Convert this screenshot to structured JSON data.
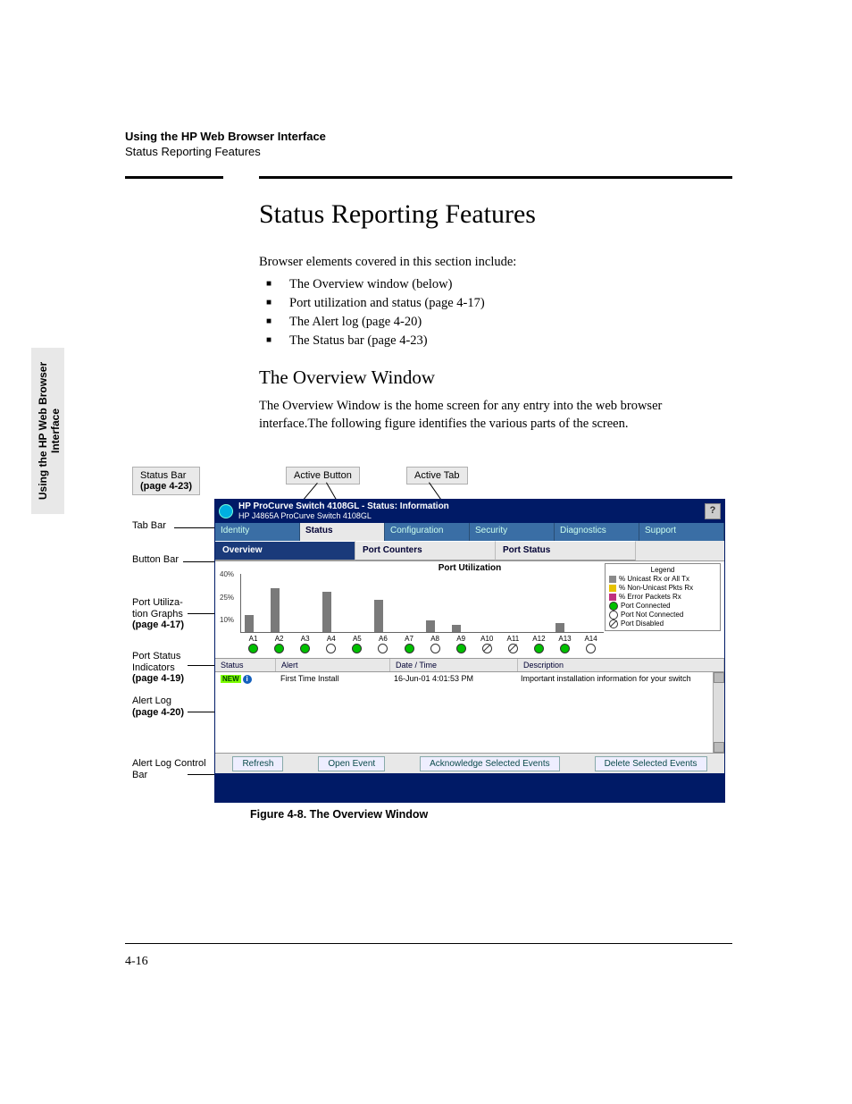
{
  "running_head": {
    "bold": "Using the HP Web Browser Interface",
    "reg": "Status Reporting Features"
  },
  "section_title": "Status Reporting Features",
  "intro": "Browser elements covered in this section include:",
  "bullets": [
    "The Overview window (below)",
    "Port utilization and status (page 4-17)",
    "The Alert log (page 4-20)",
    "The Status bar (page 4-23)"
  ],
  "subhead": "The Overview Window",
  "body": "The Overview Window is the home screen for any entry into the web browser interface.The following figure identifies the various parts of the screen.",
  "side_tab": {
    "line1": "Using the HP Web Browser",
    "line2": "Interface"
  },
  "top_labels": {
    "status_bar": "Status Bar",
    "status_bar_page": "(page 4-23)",
    "active_button": "Active Button",
    "active_tab": "Active Tab"
  },
  "callouts": {
    "tab_bar": "Tab Bar",
    "button_bar": "Button Bar",
    "port_util": "Port Utiliza-\ntion Graphs",
    "port_util_page": "(page 4-17)",
    "port_status": "Port Status Indicators",
    "port_status_page": "(page 4-19)",
    "alert_log": "Alert Log",
    "alert_log_page": "(page 4-20)",
    "alert_ctl": "Alert Log Control Bar"
  },
  "screenshot": {
    "title": "HP ProCurve Switch 4108GL - Status: Information",
    "subtitle": "HP J4865A ProCurve Switch 4108GL",
    "help_glyph": "?",
    "tabs": [
      "Identity",
      "Status",
      "Configuration",
      "Security",
      "Diagnostics",
      "Support"
    ],
    "active_tab_index": 1,
    "buttons": [
      "Overview",
      "Port Counters",
      "Port Status"
    ],
    "active_button_index": 0,
    "chart_title": "Port Utilization",
    "legend_title": "Legend",
    "legend": {
      "unicast": "% Unicast Rx or All Tx",
      "nonuni": "% Non-Unicast Pkts Rx",
      "error": "% Error Packets Rx",
      "conn": "Port Connected",
      "notconn": "Port Not Connected",
      "disabled": "Port Disabled"
    },
    "colors": {
      "unicast": "#8a8a8a",
      "nonuni": "#e6c200",
      "error": "#c03080",
      "conn": "#00c000",
      "notconn": "#ffffff",
      "disabled": "#ffffff"
    },
    "alert_headers": {
      "status": "Status",
      "alert": "Alert",
      "datetime": "Date / Time",
      "description": "Description"
    },
    "alert_row": {
      "new": "NEW",
      "alert": "First Time Install",
      "datetime": "16-Jun-01 4:01:53 PM",
      "description": "Important installation information for your switch"
    },
    "controls": {
      "refresh": "Refresh",
      "open": "Open Event",
      "ack": "Acknowledge Selected Events",
      "delete": "Delete Selected Events"
    }
  },
  "chart_data": {
    "type": "bar",
    "title": "Port Utilization",
    "ylabel": "%",
    "ylim": [
      0,
      40
    ],
    "yticks": [
      40,
      25,
      10
    ],
    "categories": [
      "A1",
      "A2",
      "A3",
      "A4",
      "A5",
      "A6",
      "A7",
      "A8",
      "A9",
      "A10",
      "A11",
      "A12",
      "A13",
      "A14"
    ],
    "values": [
      12,
      30,
      0,
      28,
      0,
      22,
      0,
      8,
      5,
      0,
      0,
      0,
      6,
      0
    ],
    "port_status": [
      "conn",
      "conn",
      "conn",
      "notconn",
      "conn",
      "notconn",
      "conn",
      "notconn",
      "conn",
      "disabled",
      "disabled",
      "conn",
      "conn",
      "notconn"
    ]
  },
  "figure_caption": "Figure 4-8.   The Overview Window",
  "page_number": "4-16"
}
